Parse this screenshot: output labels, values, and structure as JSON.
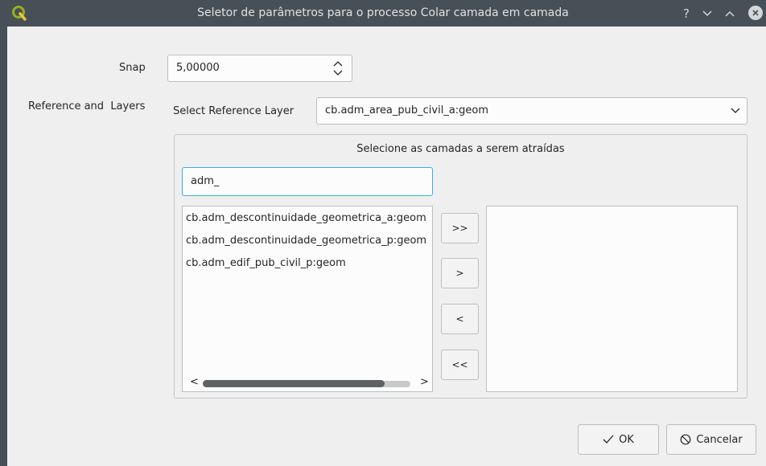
{
  "window": {
    "title": "Seletor de parâmetros para o processo Colar camada em camada",
    "app_icon": "qgis-logo-icon",
    "controls": [
      "help-icon",
      "minimize-icon",
      "maximize-icon",
      "close-icon"
    ],
    "help_glyph": "?"
  },
  "form": {
    "snap_label": "Snap",
    "snap_value": "5,00000",
    "reference_label": "Reference and  Layers",
    "select_reference_label": "Select Reference Layer",
    "reference_layer_value": "cb.adm_area_pub_civil_a:geom"
  },
  "group": {
    "title": "Selecione as camadas a serem atraídas",
    "filter_value": "adm_",
    "available_layers": [
      "cb.adm_descontinuidade_geometrica_a:geom",
      "cb.adm_descontinuidade_geometrica_p:geom",
      "cb.adm_edif_pub_civil_p:geom"
    ],
    "selected_layers": [],
    "move_all_right": ">>",
    "move_right": ">",
    "move_left": "<",
    "move_all_left": "<<",
    "hscroll_left": "<",
    "hscroll_right": ">",
    "hscroll_position": 0.88
  },
  "buttons": {
    "ok_label": "OK",
    "cancel_label": "Cancelar"
  },
  "colors": {
    "titlebar": "#475057",
    "focus_accent": "#3daee9",
    "background": "#efefef"
  }
}
